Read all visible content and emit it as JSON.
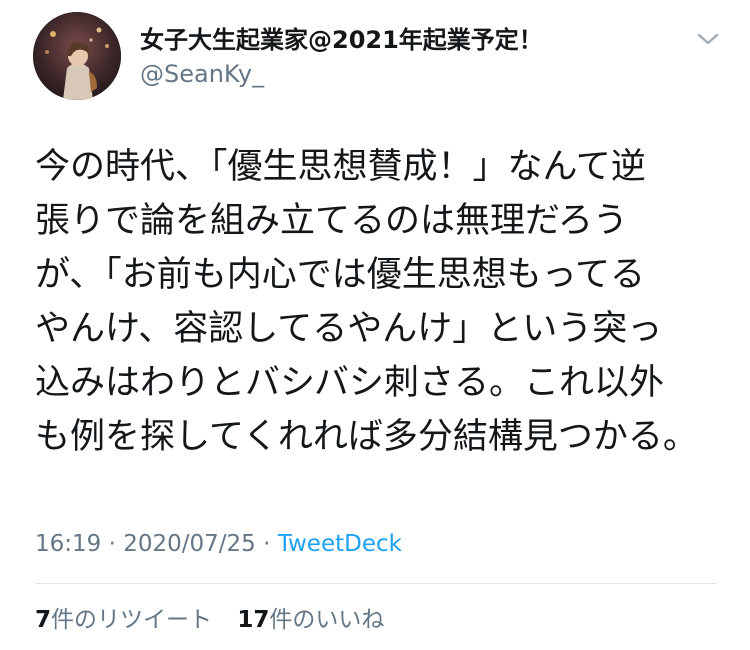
{
  "user": {
    "display_name": "女子大生起業家@2021年起業予定！",
    "handle": "@SeanKy_"
  },
  "tweet": {
    "lines": [
      "今の時代、「優生思想賛成！」なんて逆",
      "張りで論を組み立てるのは無理だろう",
      "が、「お前も内心では優生思想もってる",
      "やんけ、容認してるやんけ」という突っ",
      "込みはわりとバシバシ刺さる。これ以外",
      "も例を探してくれれば多分結構見つかる。"
    ]
  },
  "meta": {
    "time": "16:19",
    "separator1": " · ",
    "date": "2020/07/25",
    "separator2": " · ",
    "source": "TweetDeck"
  },
  "stats": {
    "retweets_count": "7",
    "retweets_label": "件のリツイート",
    "likes_count": "17",
    "likes_label": "件のいいね"
  },
  "icons": {
    "more": "chevron-down-icon",
    "avatar": "profile-photo"
  },
  "colors": {
    "text": "#14171a",
    "secondary": "#657786",
    "link": "#1da1f2",
    "divider": "#e1e8ed"
  }
}
